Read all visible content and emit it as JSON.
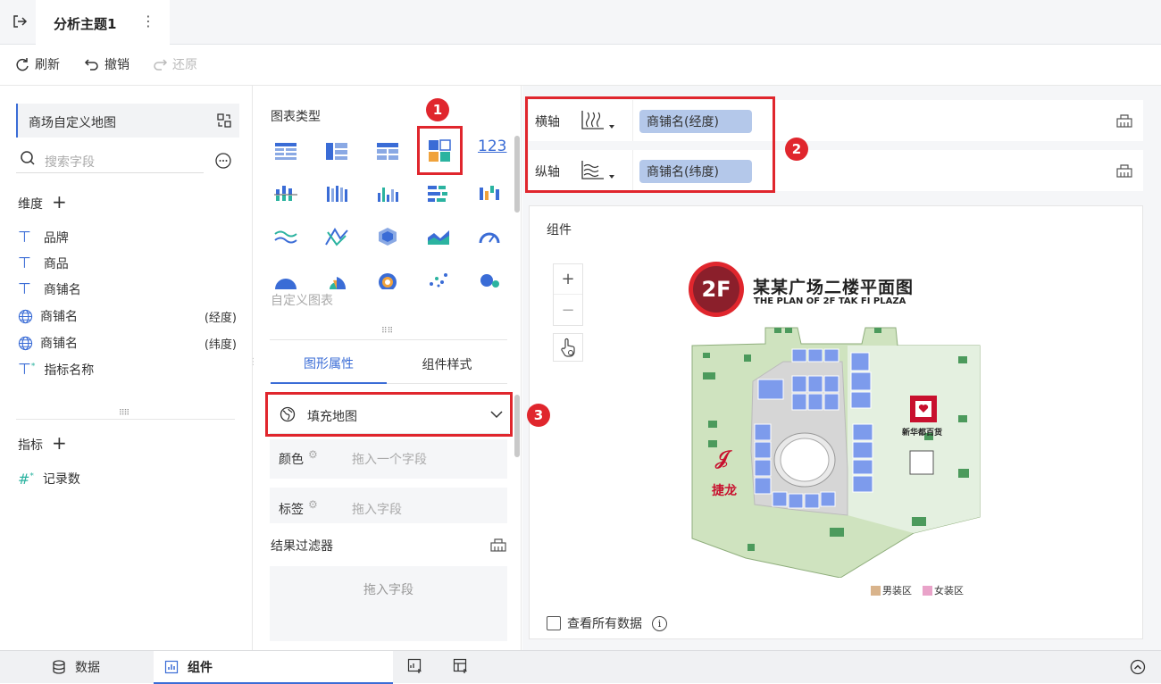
{
  "topbar": {
    "title": "分析主题1"
  },
  "toolbar": {
    "refresh": "刷新",
    "undo": "撤销",
    "redo": "还原"
  },
  "left": {
    "dataset": "商场自定义地图",
    "search_placeholder": "搜索字段",
    "dimension_title": "维度",
    "dimensions": [
      {
        "label": "品牌",
        "suffix": ""
      },
      {
        "label": "商品",
        "suffix": ""
      },
      {
        "label": "商铺名",
        "suffix": ""
      },
      {
        "label": "商铺名",
        "suffix": "(经度)"
      },
      {
        "label": "商铺名",
        "suffix": "(纬度)"
      },
      {
        "label": "指标名称",
        "suffix": ""
      }
    ],
    "measure_title": "指标",
    "measures": [
      {
        "label": "记录数"
      }
    ]
  },
  "middle": {
    "chart_type_title": "图表类型",
    "custom_chart": "自定义图表",
    "chart_123": "123",
    "tabs": [
      "图形属性",
      "组件样式"
    ],
    "map_type": "填充地图",
    "color_label": "颜色",
    "color_placeholder": "拖入一个字段",
    "tag_label": "标签",
    "tag_placeholder": "拖入字段",
    "filter_title": "结果过滤器",
    "filter_placeholder": "拖入字段"
  },
  "axes": {
    "x_label": "横轴",
    "x_field": "商铺名(经度)",
    "y_label": "纵轴",
    "y_field": "商铺名(纬度)"
  },
  "canvas": {
    "title": "组件",
    "zoom_in": "+",
    "zoom_out": "−",
    "show_all": "查看所有数据"
  },
  "map": {
    "badge": "2F",
    "title_cn": "某某广场二楼平面图",
    "title_en": "THE PLAN OF 2F TAK FI PLAZA",
    "store_right": "新华都百货",
    "store_left": "捷龙",
    "legend": [
      {
        "label": "男装区",
        "color": "#d9b48c"
      },
      {
        "label": "女装区",
        "color": "#e9a3c9"
      }
    ]
  },
  "annotations": [
    "1",
    "2",
    "3"
  ],
  "bottom": {
    "tabs": [
      "数据",
      "组件"
    ]
  },
  "colors": {
    "accent": "#3a6cd6",
    "highlight": "#e0262d",
    "pill": "#b4c8ea"
  }
}
